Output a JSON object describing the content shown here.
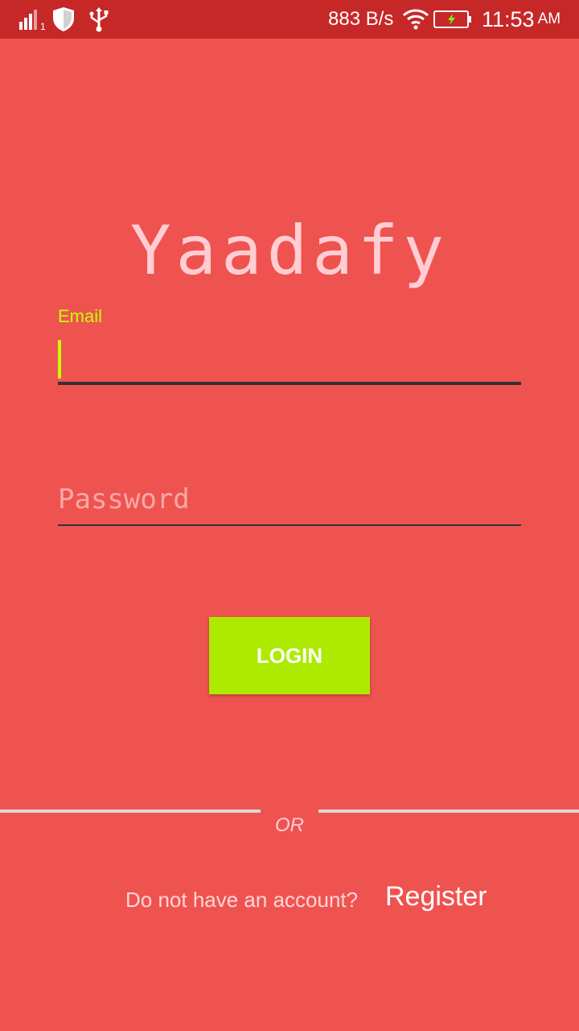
{
  "status_bar": {
    "network_speed": "883 B/s",
    "time": "11:53",
    "ampm": "AM",
    "signal_sub": "1",
    "icons": [
      "signal-icon",
      "shield-icon",
      "usb-icon",
      "wifi-icon",
      "battery-charging-icon"
    ]
  },
  "app": {
    "title": "Yaadafy"
  },
  "form": {
    "email_label": "Email",
    "email_value": "",
    "password_placeholder": "Password",
    "login_label": "LOGIN"
  },
  "footer": {
    "or_text": "OR",
    "no_account_text": "Do not have an account?",
    "register_label": "Register"
  },
  "colors": {
    "background": "#EF5350",
    "status_bar": "#C62828",
    "accent": "#C6FF00",
    "button": "#AEEA00"
  }
}
